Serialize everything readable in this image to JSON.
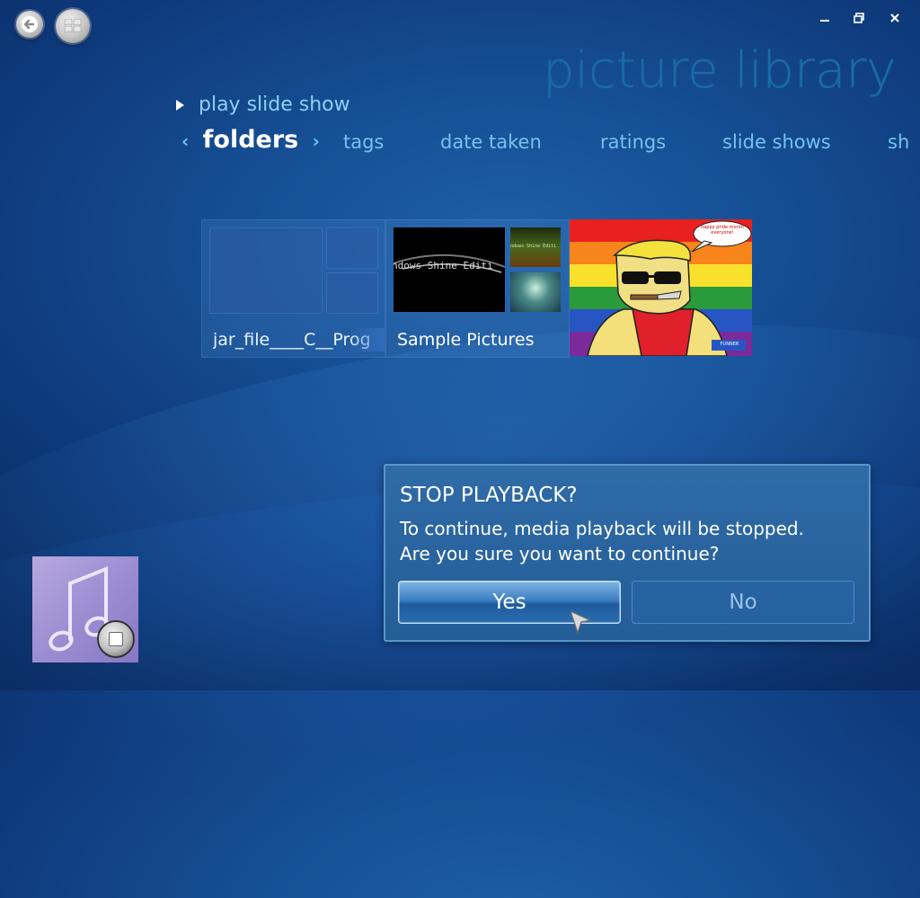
{
  "window": {
    "title": "picture library",
    "minimize_glyph": "▁",
    "restore_glyph": "▣",
    "close_glyph": "✕"
  },
  "play_slide_show": "play slide show",
  "nav": {
    "items": [
      "folders",
      "tags",
      "date taken",
      "ratings",
      "slide shows",
      "sh"
    ],
    "active": "folders"
  },
  "tiles": [
    {
      "label": "jar_file____C__Prog"
    },
    {
      "label": "Sample Pictures",
      "thumb_text": "ndows Shine Editi",
      "small_text": "ndows Shine Editi"
    },
    {
      "label": "",
      "speech": "happy pride month everyone!",
      "tag": "FUNNER"
    }
  ],
  "dialog": {
    "title": "STOP PLAYBACK?",
    "line1": "To continue, media playback will be stopped.",
    "line2": "Are you sure you want to continue?",
    "yes": "Yes",
    "no": "No"
  },
  "now_playing": {
    "icon": "music-note-icon"
  },
  "colors": {
    "background": "#154d92",
    "title": "#1b6aa8",
    "nav_inactive": "#74c3ee",
    "nav_active": "#ffffff",
    "dialog_bg": "#2f6ba7",
    "now_playing_bg": "#9d8ed2"
  }
}
